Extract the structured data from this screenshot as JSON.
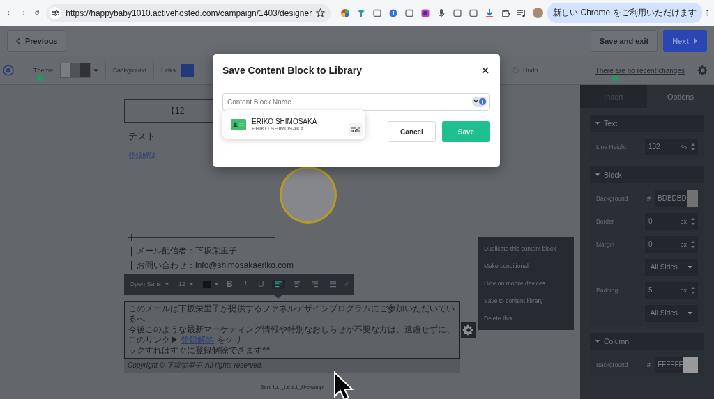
{
  "browser": {
    "url": "https://happybaby1010.activehosted.com/campaign/1403/designer",
    "update_banner": "新しい Chrome をご利用いただけます"
  },
  "header": {
    "previous": "Previous",
    "save_exit": "Save and exit",
    "next": "Next"
  },
  "toolbar": {
    "theme": "Theme",
    "background": "Background",
    "links": "Links",
    "undo": "Undo",
    "changes": "There are no recent changes"
  },
  "email": {
    "header_text": "【12",
    "title": "テスト",
    "unsubscribe": "登録解除",
    "sender": "メール配信者：下坂栄里子",
    "contact": "お問い合わせ：info@shimosakaeriko.com",
    "text_toolbar": {
      "font": "Open Sans",
      "size": "12",
      "styles": [
        {
          "kind": "bold",
          "label": "B"
        },
        {
          "kind": "italic",
          "label": "I"
        },
        {
          "kind": "underline",
          "label": "U"
        }
      ],
      "alignments": [
        {
          "kind": "left",
          "selected": true
        },
        {
          "kind": "center",
          "selected": false
        },
        {
          "kind": "right",
          "selected": false
        },
        {
          "kind": "justify",
          "selected": false
        }
      ]
    },
    "paragraph": [
      [
        {
          "text": "このメールは下坂栄里子が提供するファネルデザインプログラムにご参加いただいているへ"
        }
      ],
      [
        {
          "text": "今後このような最新マーケティング情報や特別なおしらせが不要な方は、遠慮せずに、このリンク▶ "
        },
        {
          "text": "登録解除",
          "link": true
        },
        {
          "text": " をクリ"
        }
      ],
      [
        {
          "text": "ックすればすぐに登録解除できます^^"
        }
      ]
    ],
    "copyright": "Copyright ©  下坂栄里子, All rights reserved.",
    "sent_to": "Sent to: _t.e.s.t_@exampl"
  },
  "context_menu": [
    "Duplicate this content block",
    "Make conditional",
    "Hide on mobile devices",
    "Save to content library",
    "Delete this"
  ],
  "panel": {
    "tabs": [
      {
        "label": "Insert",
        "selected": false
      },
      {
        "label": "Options",
        "selected": true
      }
    ],
    "sections": [
      {
        "title": "Text",
        "expanded": true,
        "rows": [
          {
            "kind": "number",
            "label": "Line Height",
            "value": "132",
            "unit": "%"
          }
        ]
      },
      {
        "title": "Block",
        "expanded": true,
        "rows": [
          {
            "kind": "color",
            "label": "Background",
            "prefix": "#",
            "value": "BDBDBD"
          },
          {
            "kind": "number",
            "label": "Border",
            "value": "0",
            "unit": "px"
          },
          {
            "kind": "number",
            "label": "Margin",
            "value": "0",
            "unit": "px"
          },
          {
            "kind": "select",
            "value": "All Sides"
          },
          {
            "kind": "number",
            "label": "Padding",
            "value": "5",
            "unit": "px"
          },
          {
            "kind": "select",
            "value": "All Sides"
          }
        ]
      },
      {
        "title": "Column",
        "expanded": true,
        "rows": [
          {
            "kind": "color",
            "label": "Background",
            "prefix": "#",
            "value": "FFFFFF"
          }
        ]
      }
    ]
  },
  "modal": {
    "title": "Save Content Block to Library",
    "placeholder": "Content Block Name",
    "suggestion": {
      "name": "ERIKO SHIMOSAKA",
      "detail": "ERIKO SHIMOSAKA"
    },
    "cancel": "Cancel",
    "save": "Save"
  }
}
